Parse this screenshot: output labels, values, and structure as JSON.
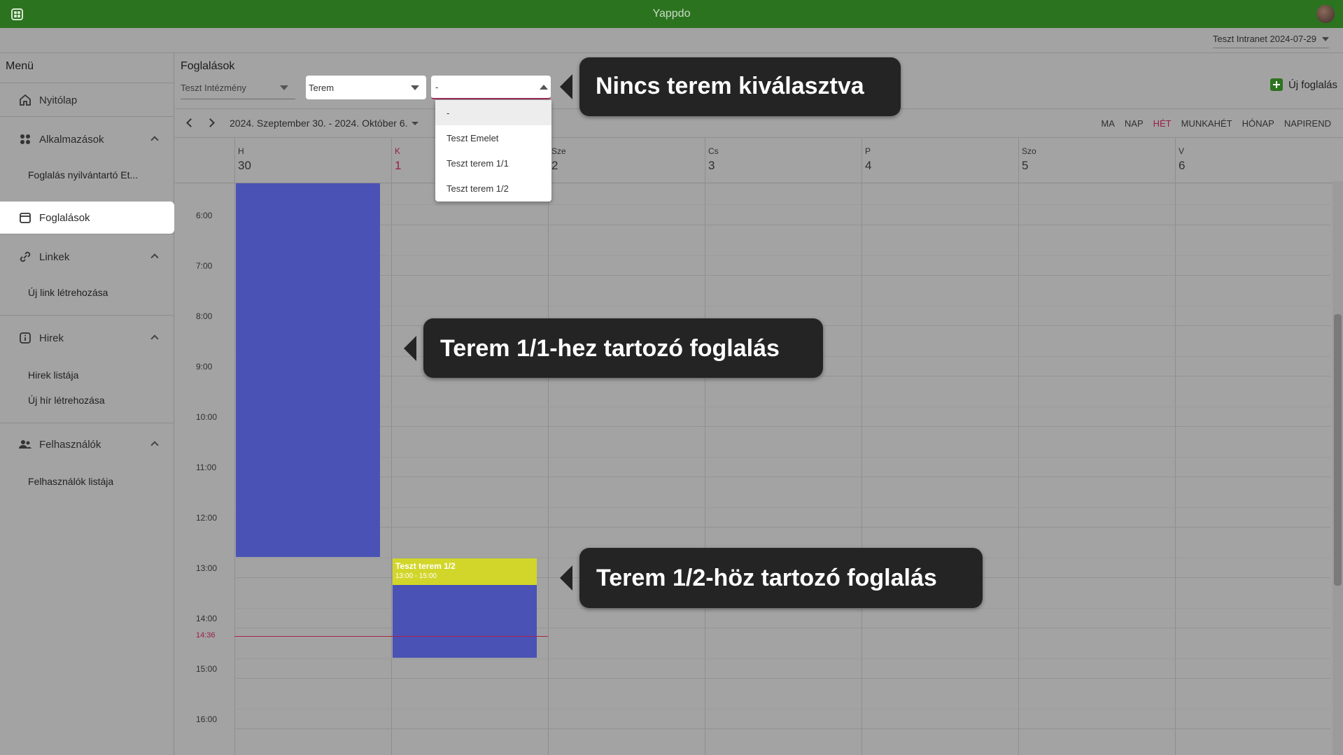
{
  "app": {
    "title": "Yappdo"
  },
  "tenant": {
    "label": "Teszt Intranet 2024-07-29"
  },
  "sidebar": {
    "title": "Menü",
    "items": [
      {
        "label": "Nyitólap",
        "icon": "home-icon"
      },
      {
        "label": "Alkalmazások",
        "icon": "apps-icon",
        "children": [
          "Foglalás nyilvántartó Et..."
        ]
      },
      {
        "label": "Foglalások",
        "icon": "calendar-icon",
        "active": true
      },
      {
        "label": "Linkek",
        "icon": "link-icon",
        "children": [
          "Új link létrehozása"
        ]
      },
      {
        "label": "Hirek",
        "icon": "info-icon",
        "children": [
          "Hirek listája",
          "Új hír létrehozása"
        ]
      },
      {
        "label": "Felhasználók",
        "icon": "users-icon",
        "children": [
          "Felhasználók listája"
        ]
      }
    ]
  },
  "main": {
    "title": "Foglalások",
    "filters": {
      "institution": "Teszt Intézmény",
      "room_type": "Terem",
      "room": "-"
    },
    "new_button": "Új foglalás",
    "date_range": "2024. Szeptember 30. - 2024. Október 6.",
    "views": [
      "MA",
      "NAP",
      "HÉT",
      "MUNKAHÉT",
      "HÓNAP",
      "NAPIREND"
    ],
    "active_view": "HÉT",
    "days": [
      {
        "name": "H",
        "num": "30"
      },
      {
        "name": "K",
        "num": "1",
        "today": true
      },
      {
        "name": "Sze",
        "num": "2"
      },
      {
        "name": "Cs",
        "num": "3"
      },
      {
        "name": "P",
        "num": "4"
      },
      {
        "name": "Szo",
        "num": "5"
      },
      {
        "name": "V",
        "num": "6"
      }
    ],
    "hours": [
      "6:00",
      "7:00",
      "8:00",
      "9:00",
      "10:00",
      "11:00",
      "12:00",
      "13:00",
      "14:00",
      "15:00",
      "16:00"
    ],
    "now_label": "14:36",
    "dropdown_options": [
      "-",
      "Teszt Emelet",
      "Teszt terem 1/1",
      "Teszt terem 1/2"
    ],
    "event": {
      "title": "Teszt terem 1/2",
      "time": "13:00 - 15:00"
    }
  },
  "callouts": {
    "no_room": "Nincs terem kiválasztva",
    "room_1_1": "Terem 1/1-hez tartozó foglalás",
    "room_1_2": "Terem 1/2-höz tartozó foglalás"
  },
  "colors": {
    "brand": "#2c7320",
    "event": "#4a52b5",
    "event_header": "#d2d62a",
    "accent": "#9a1f4a"
  }
}
